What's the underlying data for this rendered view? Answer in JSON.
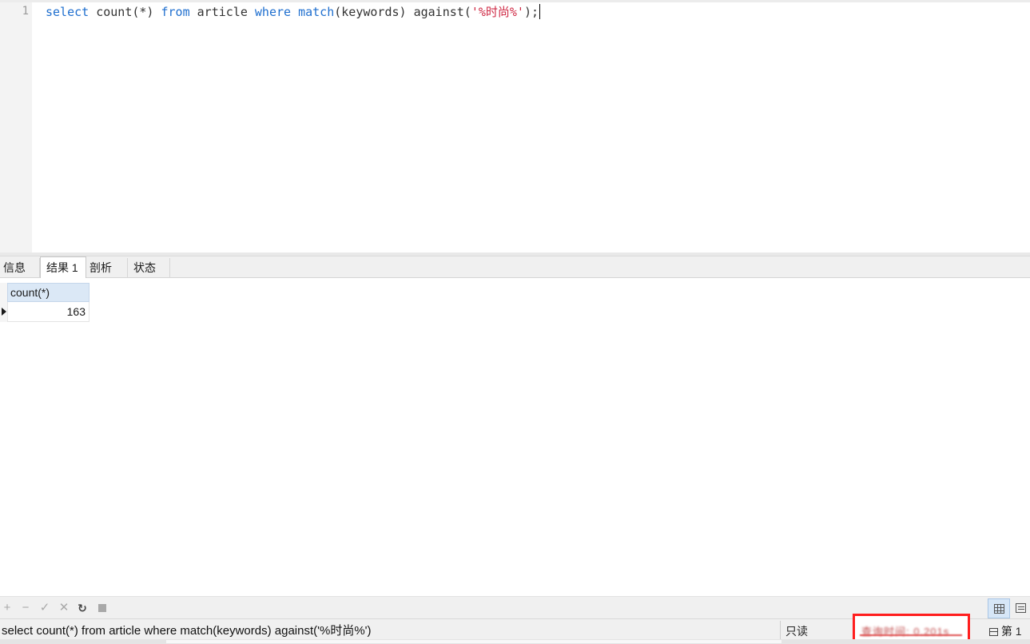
{
  "editor": {
    "line_numbers": [
      "1"
    ],
    "sql_tokens": [
      {
        "text": "select",
        "cls": "kw"
      },
      {
        "text": " count(*) ",
        "cls": ""
      },
      {
        "text": "from",
        "cls": "kw"
      },
      {
        "text": " article ",
        "cls": ""
      },
      {
        "text": "where",
        "cls": "kw"
      },
      {
        "text": " ",
        "cls": ""
      },
      {
        "text": "match",
        "cls": "kw"
      },
      {
        "text": "(keywords) against(",
        "cls": ""
      },
      {
        "text": "'%时尚%'",
        "cls": "str"
      },
      {
        "text": ");",
        "cls": ""
      }
    ],
    "colors": {
      "keyword": "#1f6fcf",
      "string": "#cf2a45",
      "text": "#333333"
    }
  },
  "tabs": [
    {
      "label": "信息",
      "active": false
    },
    {
      "label": "结果 1",
      "active": true
    },
    {
      "label": "剖析",
      "active": false
    },
    {
      "label": "状态",
      "active": false
    }
  ],
  "result_grid": {
    "columns": [
      "count(*)"
    ],
    "rows": [
      [
        "163"
      ]
    ]
  },
  "toolbar": {
    "add": "+",
    "remove": "−",
    "apply": "✓",
    "cancel": "✕",
    "refresh": "↻",
    "view_grid": "grid-view-icon",
    "view_form": "form-view-icon"
  },
  "statusbar": {
    "sql": "select count(*) from article where match(keywords) against('%时尚%')",
    "readonly": "只读",
    "query_time": "查询时间: 0.201s",
    "record": "第 1",
    "highlight_color": "#ff1e1e"
  }
}
